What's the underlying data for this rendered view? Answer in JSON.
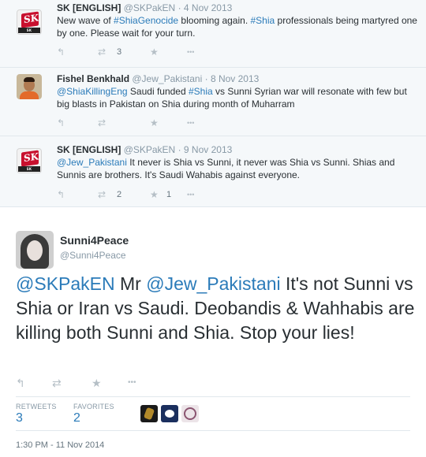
{
  "thread": [
    {
      "name": "SK [ENGLISH]",
      "handle": "@SKPakEN",
      "date": "· 4 Nov 2013",
      "text_parts": [
        {
          "t": "New wave of ",
          "link": false
        },
        {
          "t": "#ShiaGenocide",
          "link": true
        },
        {
          "t": " blooming again. ",
          "link": false
        },
        {
          "t": "#Shia",
          "link": true
        },
        {
          "t": " professionals being martyred one by one. Please wait for your turn.",
          "link": false
        }
      ],
      "avatar_caption": "SK ENGLISH",
      "avatar_letter": "SK",
      "retweets": "3",
      "favorites": ""
    },
    {
      "name": "Fishel Benkhald",
      "handle": "@Jew_Pakistani",
      "date": "· 8 Nov 2013",
      "text_parts": [
        {
          "t": "@ShiaKillingEng",
          "link": true
        },
        {
          "t": " Saudi funded ",
          "link": false
        },
        {
          "t": "#Shia",
          "link": true
        },
        {
          "t": " vs Sunni Syrian war will resonate with few but big blasts in Pakistan on Shia during month of Muharram",
          "link": false
        }
      ],
      "retweets": "",
      "favorites": ""
    },
    {
      "name": "SK [ENGLISH]",
      "handle": "@SKPakEN",
      "date": "· 9 Nov 2013",
      "text_parts": [
        {
          "t": "@Jew_Pakistani",
          "link": true
        },
        {
          "t": " It never is Shia vs Sunni, it never was Shia vs Sunni. Shias and Sunnis are brothers. It's Saudi Wahabis against everyone.",
          "link": false
        }
      ],
      "avatar_caption": "SK ENGLISH",
      "avatar_letter": "SK",
      "retweets": "2",
      "favorites": "1"
    }
  ],
  "main_tweet": {
    "name": "Sunni4Peace",
    "handle": "@Sunni4Peace",
    "text_parts": [
      {
        "t": "@SKPakEN",
        "link": true
      },
      {
        "t": " Mr ",
        "link": false
      },
      {
        "t": "@Jew_Pakistani",
        "link": true
      },
      {
        "t": " It's not Sunni vs Shia or Iran vs Saudi. Deobandis & Wahhabis are killing both Sunni and Shia. Stop your lies!",
        "link": false
      }
    ],
    "retweets_label": "RETWEETS",
    "retweets": "3",
    "favorites_label": "FAVORITES",
    "favorites": "2",
    "timestamp": "1:30 PM - 11 Nov 2014"
  },
  "icons": {
    "reply": "↰",
    "retweet": "⇄",
    "favorite": "★",
    "more": "•••"
  },
  "colors": {
    "link": "#2b7bb9",
    "thread_bg": "#f5f8fa",
    "action_gray": "#b5bfc6"
  }
}
